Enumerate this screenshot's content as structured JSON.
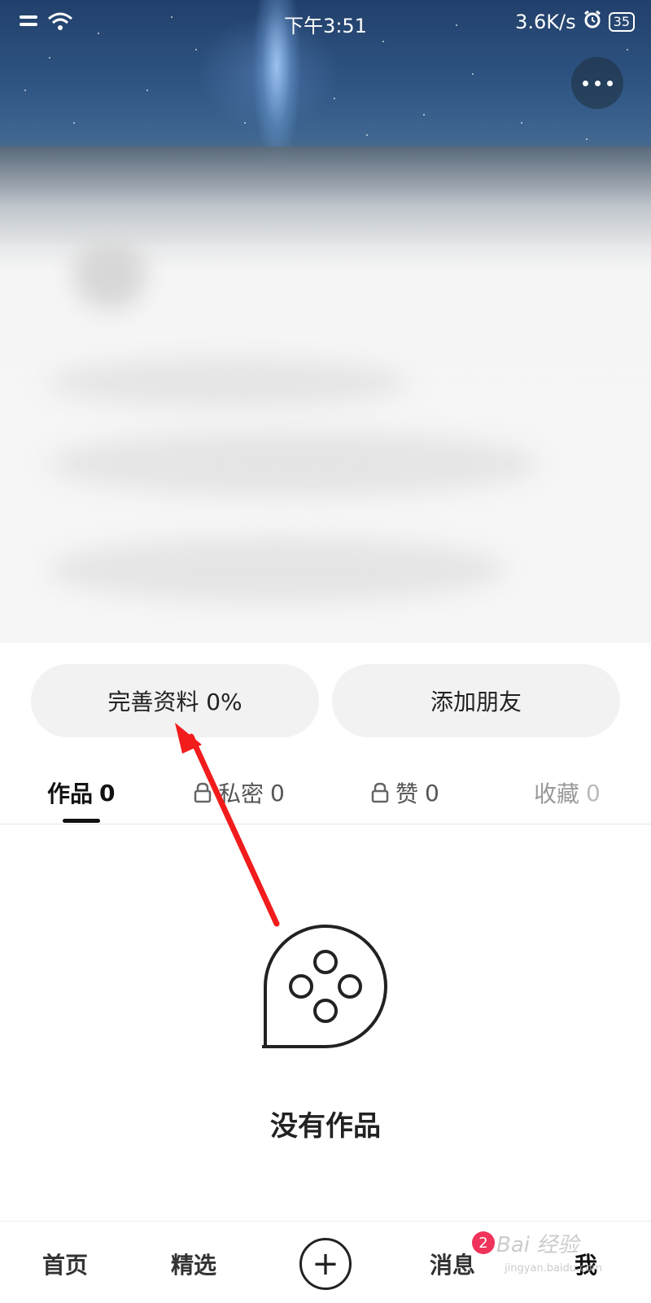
{
  "status_bar": {
    "time": "下午3:51",
    "network_speed": "3.6K/s",
    "battery": "35"
  },
  "profile": {
    "complete_profile_label": "完善资料 0%",
    "add_friends_label": "添加朋友"
  },
  "tabs": [
    {
      "label": "作品",
      "count": "0"
    },
    {
      "label": "私密",
      "count": "0"
    },
    {
      "label": "赞",
      "count": "0"
    },
    {
      "label": "收藏",
      "count": "0"
    }
  ],
  "empty_state": {
    "text": "没有作品"
  },
  "bottom_nav": {
    "home": "首页",
    "featured": "精选",
    "messages": "消息",
    "messages_badge": "2",
    "me": "我"
  },
  "watermark": {
    "brand": "Bai 经验",
    "url": "jingyan.baidu.com"
  },
  "colors": {
    "accent": "#f0335a",
    "annotation_arrow": "#f21c1c"
  }
}
